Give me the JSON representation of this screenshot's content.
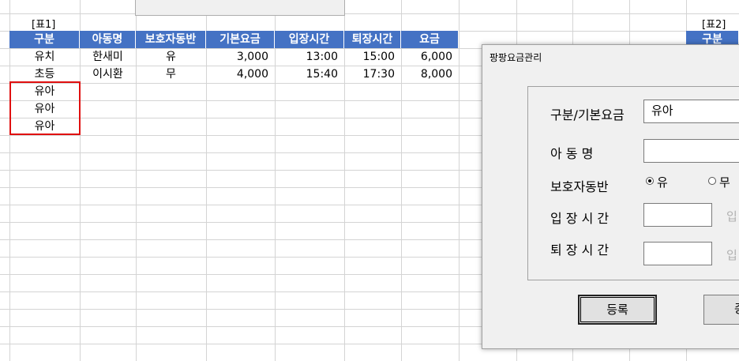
{
  "sheet": {
    "table1_label": "[표1]",
    "table2_label": "[표2]",
    "table2_header_first": "구분",
    "headers": [
      "구분",
      "아동명",
      "보호자동반",
      "기본요금",
      "입장시간",
      "퇴장시간",
      "요금"
    ],
    "rows": [
      [
        "유치",
        "한새미",
        "유",
        "3,000",
        "13:00",
        "15:00",
        "6,000"
      ],
      [
        "초등",
        "이시환",
        "무",
        "4,000",
        "15:40",
        "17:30",
        "8,000"
      ],
      [
        "유아",
        "",
        "",
        "",
        "",
        "",
        ""
      ],
      [
        "유아",
        "",
        "",
        "",
        "",
        "",
        ""
      ],
      [
        "유아",
        "",
        "",
        "",
        "",
        "",
        ""
      ]
    ]
  },
  "dialog": {
    "title": "팡팡요금관리",
    "labels": {
      "category": "구분/기본요금",
      "child_name": "아 동 명",
      "guardian": "보호자동반",
      "entry_time": "입 장 시 간",
      "exit_time": "퇴 장 시 간"
    },
    "category_value": "유아",
    "child_name_value": "",
    "radio_yes": "유",
    "radio_no": "무",
    "radio_selected": "유",
    "entry_hint": "입",
    "exit_hint": "입",
    "register_button": "등록",
    "second_button": "종"
  }
}
